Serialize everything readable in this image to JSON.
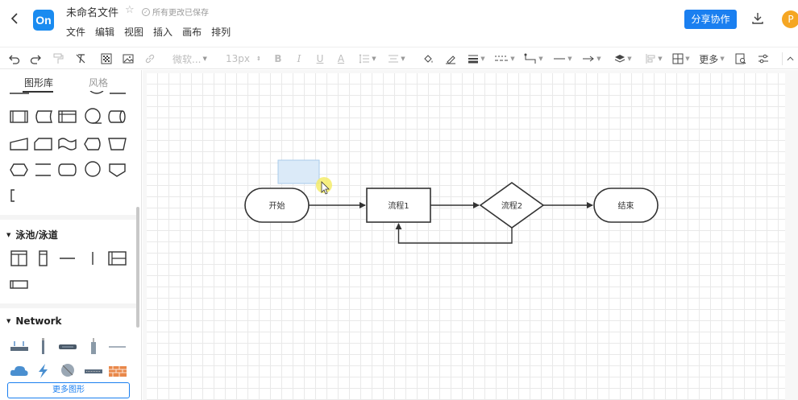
{
  "header": {
    "logo_text": "On",
    "doc_title": "未命名文件",
    "save_status": "所有更改已保存",
    "menu": [
      "文件",
      "编辑",
      "视图",
      "插入",
      "画布",
      "排列"
    ],
    "share_label": "分享协作",
    "avatar_letter": "P"
  },
  "toolbar": {
    "font_name": "微软...",
    "font_size": "13px",
    "more_label": "更多"
  },
  "sidebar": {
    "tabs": [
      "图形库",
      "风格"
    ],
    "section_swimlane": "泳池/泳道",
    "section_network": "Network",
    "more_shapes": "更多图形"
  },
  "diagram": {
    "nodes": {
      "start": "开始",
      "process1": "流程1",
      "process2": "流程2",
      "end": "结束"
    }
  },
  "colors": {
    "accent": "#1a7ff0",
    "avatar": "#f5a623",
    "selection": "#dbeaf8"
  }
}
